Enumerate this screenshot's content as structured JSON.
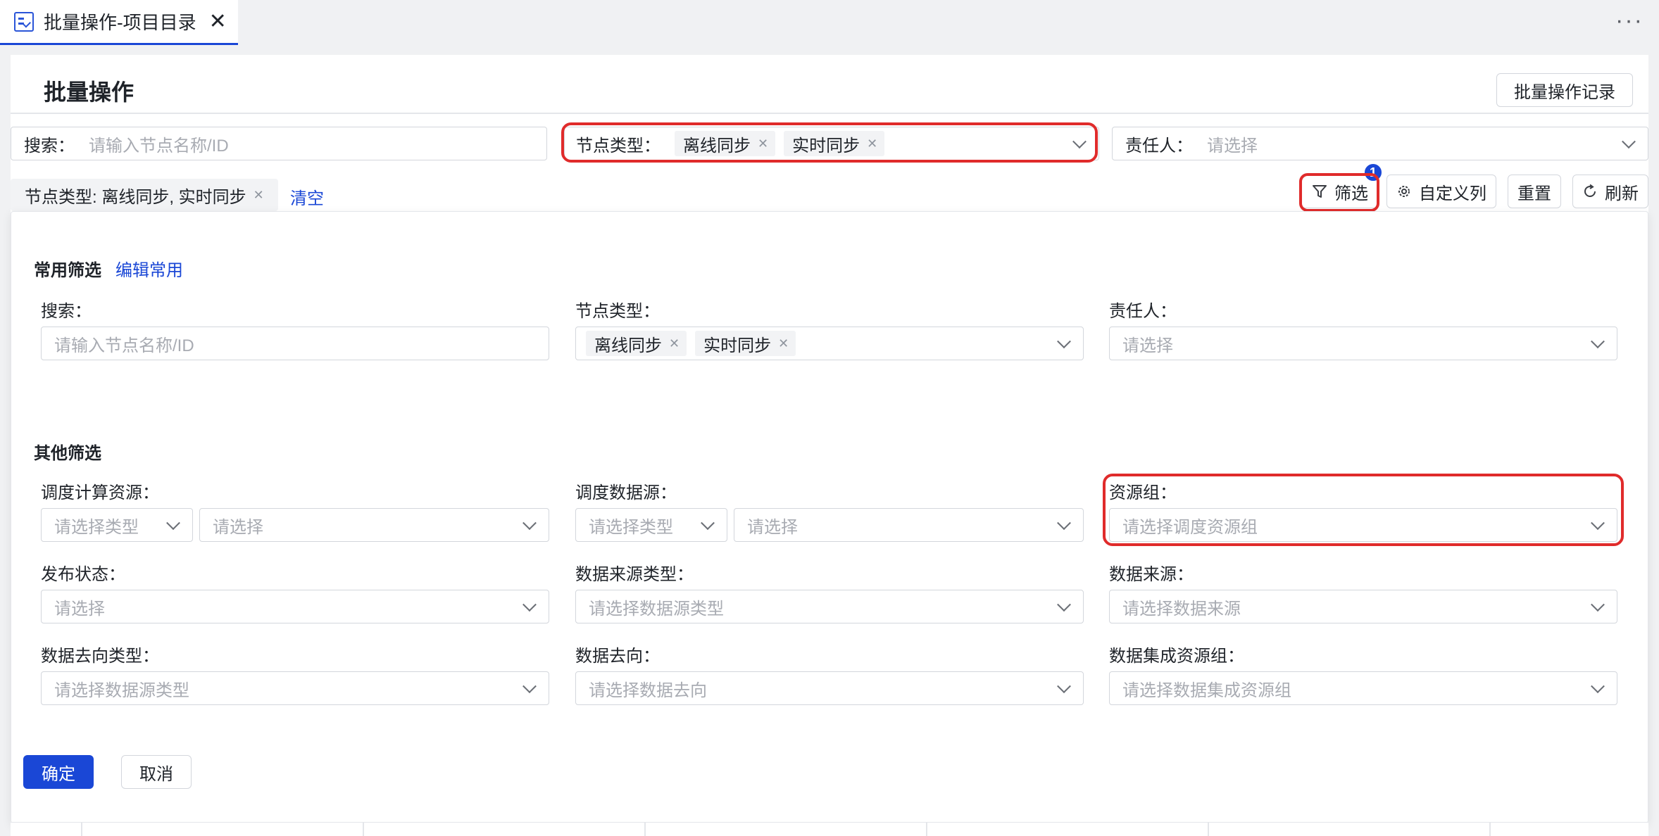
{
  "tab": {
    "title": "批量操作-项目目录",
    "close": "✕",
    "more": "···"
  },
  "header": {
    "title": "批量操作",
    "records_button": "批量操作记录"
  },
  "top_filters": {
    "search": {
      "label": "搜索：",
      "placeholder": "请输入节点名称/ID"
    },
    "node_type": {
      "label": "节点类型：",
      "tags": [
        "离线同步",
        "实时同步"
      ]
    },
    "owner": {
      "label": "责任人：",
      "placeholder": "请选择"
    }
  },
  "summary": {
    "chip": "节点类型: 离线同步, 实时同步",
    "clear": "清空"
  },
  "toolbar": {
    "filter": "筛选",
    "filter_badge": "1",
    "custom_columns": "自定义列",
    "reset": "重置",
    "refresh": "刷新"
  },
  "popover": {
    "common_title": "常用筛选",
    "edit_common": "编辑常用",
    "common": {
      "search_label": "搜索：",
      "search_placeholder": "请输入节点名称/ID",
      "node_type_label": "节点类型：",
      "node_type_tags": [
        "离线同步",
        "实时同步"
      ],
      "owner_label": "责任人：",
      "owner_placeholder": "请选择"
    },
    "other_title": "其他筛选",
    "other": {
      "compute_label": "调度计算资源：",
      "compute_type_placeholder": "请选择类型",
      "compute_placeholder": "请选择",
      "datasource_label": "调度数据源：",
      "datasource_type_placeholder": "请选择类型",
      "datasource_placeholder": "请选择",
      "resource_group_label": "资源组：",
      "resource_group_placeholder": "请选择调度资源组",
      "publish_label": "发布状态：",
      "publish_placeholder": "请选择",
      "source_type_label": "数据来源类型：",
      "source_type_placeholder": "请选择数据源类型",
      "source_label": "数据来源：",
      "source_placeholder": "请选择数据来源",
      "dest_type_label": "数据去向类型：",
      "dest_type_placeholder": "请选择数据源类型",
      "dest_label": "数据去向：",
      "dest_placeholder": "请选择数据去向",
      "integration_group_label": "数据集成资源组：",
      "integration_group_placeholder": "请选择数据集成资源组"
    },
    "confirm": "确定",
    "cancel": "取消"
  },
  "colors": {
    "accent": "#1a47d6",
    "highlight": "#e02b2b"
  }
}
